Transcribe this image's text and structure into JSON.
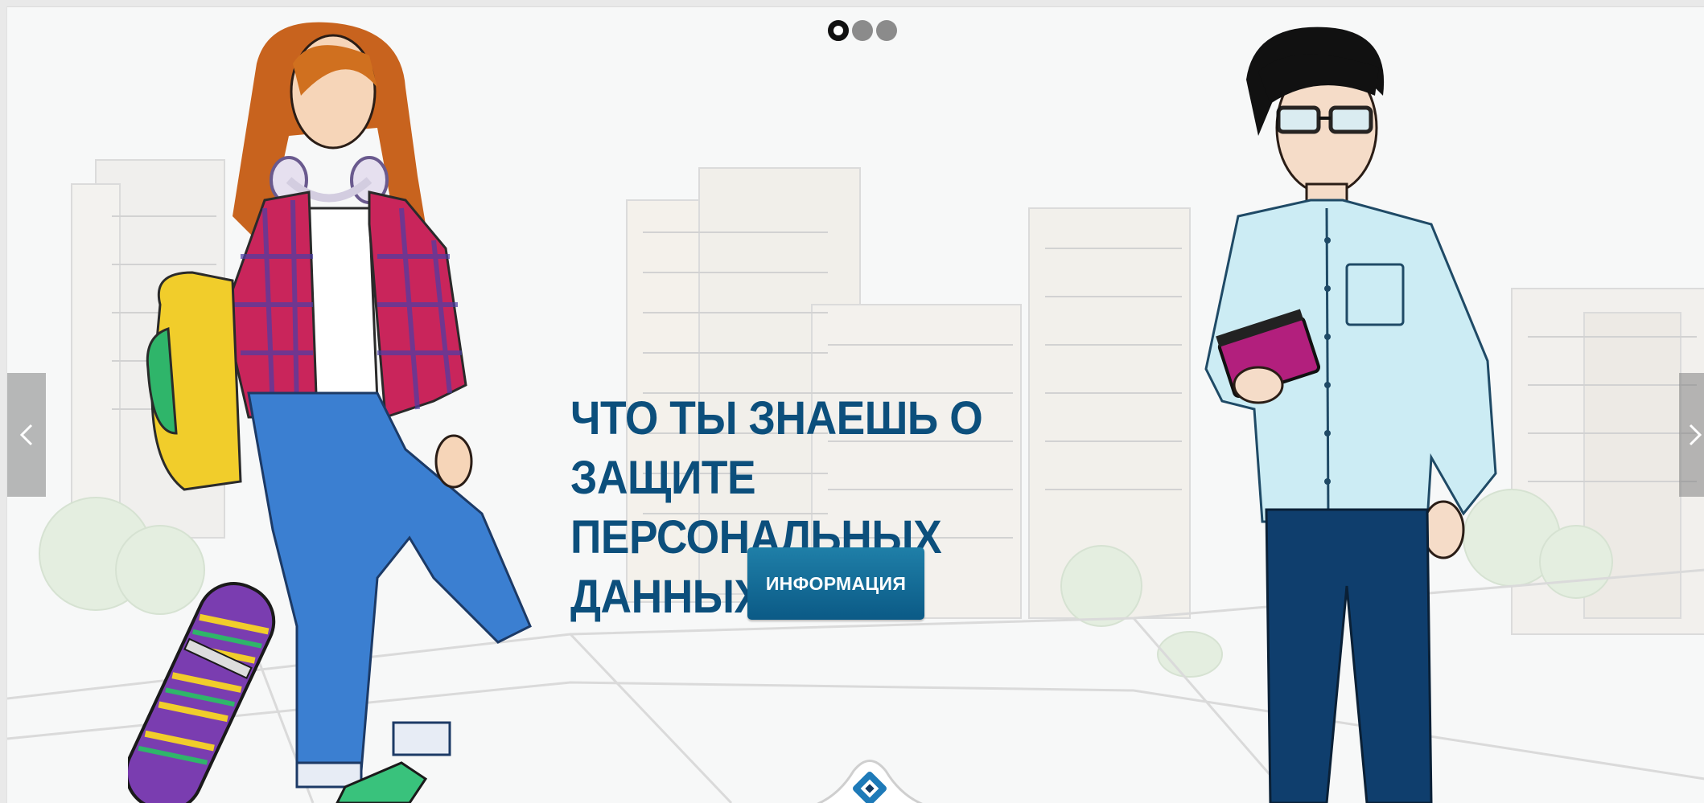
{
  "slider": {
    "headline_line1": "ЧТО ТЫ ЗНАЕШЬ О ЗАЩИТЕ",
    "headline_line2": "ПЕРСОНАЛЬНЫХ ДАННЫХ?",
    "button_label": "ИНФОРМАЦИЯ",
    "prev_label": "‹",
    "next_label": "›",
    "dots": 3,
    "active_dot": 1
  },
  "colors": {
    "headline": "#0c4f7c",
    "button": "#0b5a86",
    "background": "#f7f8f8"
  },
  "icons": [
    "chevron-left-icon",
    "chevron-right-icon",
    "roskomnadzor-logo-icon"
  ]
}
